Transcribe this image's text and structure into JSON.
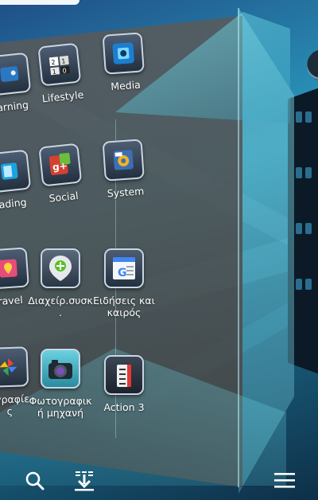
{
  "colors": {
    "accent": "#2a9bbd",
    "label": "#ffffff",
    "cube_face": "#505050"
  },
  "apps": [
    {
      "id": "gaming",
      "label": "arning",
      "icon": "gamepad-icon"
    },
    {
      "id": "lifestyle",
      "label": "Lifestyle",
      "icon": "lifestyle-icon"
    },
    {
      "id": "media",
      "label": "Media",
      "icon": "media-icon"
    },
    {
      "id": "reading",
      "label": "ading",
      "icon": "book-icon"
    },
    {
      "id": "social",
      "label": "Social",
      "icon": "google-plus-icon"
    },
    {
      "id": "system",
      "label": "System",
      "icon": "system-icon"
    },
    {
      "id": "travel",
      "label": "ravel",
      "icon": "map-icon"
    },
    {
      "id": "manager",
      "label": "Διαχείρ.συσκ\n.",
      "icon": "device-manager-icon"
    },
    {
      "id": "news",
      "label": "Ειδήσεις και\nκαιρός",
      "icon": "news-icon"
    },
    {
      "id": "photos",
      "label": "ογραφίε\nς",
      "icon": "photos-icon"
    },
    {
      "id": "camera",
      "label": "Φωτογραφικ\nή μηχανή",
      "icon": "camera-icon"
    },
    {
      "id": "action3",
      "label": "Action 3",
      "icon": "action3-icon"
    }
  ],
  "bottom_bar": {
    "search": "search-icon",
    "download": "download-icon",
    "menu": "menu-icon"
  }
}
